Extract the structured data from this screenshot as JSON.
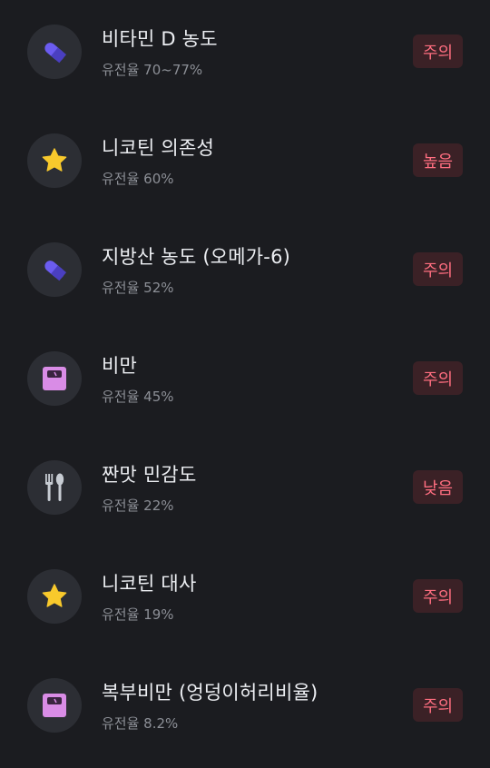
{
  "items": [
    {
      "title": "비타민 D 농도",
      "subtitle": "유전율 70~77%",
      "badge": "주의",
      "icon": "pill-icon"
    },
    {
      "title": "니코틴 의존성",
      "subtitle": "유전율 60%",
      "badge": "높음",
      "icon": "star-icon"
    },
    {
      "title": "지방산 농도 (오메가-6)",
      "subtitle": "유전율 52%",
      "badge": "주의",
      "icon": "pill-icon"
    },
    {
      "title": "비만",
      "subtitle": "유전율 45%",
      "badge": "주의",
      "icon": "scale-icon"
    },
    {
      "title": "짠맛 민감도",
      "subtitle": "유전율 22%",
      "badge": "낮음",
      "icon": "fork-spoon-icon"
    },
    {
      "title": "니코틴 대사",
      "subtitle": "유전율 19%",
      "badge": "주의",
      "icon": "star-icon"
    },
    {
      "title": "복부비만 (엉덩이허리비율)",
      "subtitle": "유전율 8.2%",
      "badge": "주의",
      "icon": "scale-icon"
    }
  ],
  "colors": {
    "background": "#1b1c20",
    "badge_bg": "#3b2126",
    "badge_text": "#ff6e80",
    "pill": "#6b5cf0",
    "star": "#f8c92c",
    "scale": "#d98ce6",
    "utensil": "#c7ccd3"
  }
}
